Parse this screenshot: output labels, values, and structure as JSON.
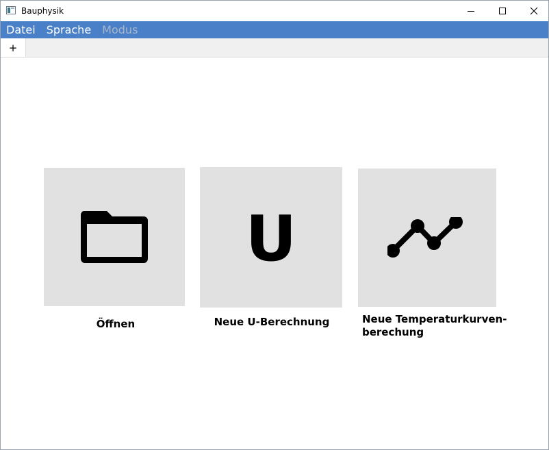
{
  "window": {
    "title": "Bauphysik"
  },
  "menu": {
    "items": [
      {
        "label": "Datei",
        "enabled": true
      },
      {
        "label": "Sprache",
        "enabled": true
      },
      {
        "label": "Modus",
        "enabled": false
      }
    ]
  },
  "tabs": {
    "add_label": "+"
  },
  "tiles": {
    "open": {
      "label": "Öffnen",
      "icon": "folder-icon"
    },
    "u_calc": {
      "label": "Neue U-Berechnung",
      "glyph": "U",
      "icon": "u-letter-icon"
    },
    "temp_curve": {
      "label_line1": "Neue Temperaturkurven-",
      "label_line2": "berechung",
      "icon": "line-chart-icon"
    }
  },
  "colors": {
    "menubar": "#4a80c8",
    "tile_background": "#e1e1e1",
    "disabled_menu": "#a9b7c9"
  }
}
